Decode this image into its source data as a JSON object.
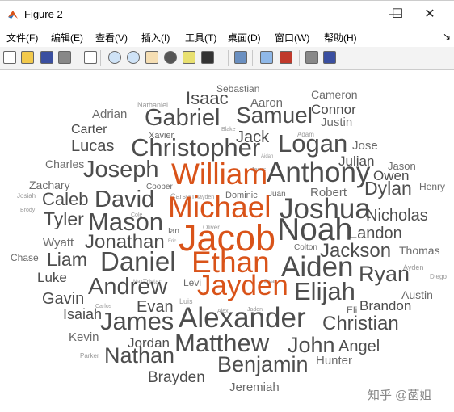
{
  "window": {
    "title": "Figure 2",
    "minimize": "—",
    "maximize": "☐",
    "close": "✕"
  },
  "menu": [
    "文件(F)",
    "编辑(E)",
    "查看(V)",
    "插入(I)",
    "工具(T)",
    "桌面(D)",
    "窗口(W)",
    "帮助(H)"
  ],
  "menu_overflow": "↘",
  "toolbar": [
    "new-file-icon",
    "open-folder-icon",
    "save-icon",
    "print-icon",
    "pointer-icon",
    "zoom-in-icon",
    "zoom-out-icon",
    "pan-icon",
    "rotate-3d-icon",
    "data-cursor-icon",
    "brush-icon",
    "link-plot-icon",
    "colorbar-icon",
    "legend-icon",
    "hide-plot-tools-icon",
    "show-plot-tools-icon"
  ],
  "colors": {
    "primary": "#4d4d4d",
    "highlight": "#d95319"
  },
  "wordcloud": {
    "highlighted": [
      "Jacob",
      "Michael",
      "Ethan",
      "William",
      "Jayden"
    ],
    "words": [
      "Sebastian",
      "Isaac",
      "Nathaniel",
      "Aaron",
      "Cameron",
      "Connor",
      "Adrian",
      "Gabriel",
      "Samuel",
      "Justin",
      "Carter",
      "Blake",
      "Xavier",
      "Adam",
      "Jack",
      "Lucas",
      "Christopher",
      "Logan",
      "Jose",
      "Aidan",
      "Charles",
      "Julian",
      "Jason",
      "Joseph",
      "Jesus",
      "William",
      "Anthony",
      "Owen",
      "Zachary",
      "Cooper",
      "Henry",
      "Dylan",
      "Josiah",
      "Caleb",
      "Carson",
      "Hayden",
      "Dominic",
      "Juan",
      "Robert",
      "David",
      "Michael",
      "Joshua",
      "Nicholas",
      "Brody",
      "Tyler",
      "Cole",
      "Mason",
      "Noah",
      "Landon",
      "Oliver",
      "Jacob",
      "Wyatt",
      "Ian",
      "Jonathan",
      "Eric",
      "Colton",
      "Thomas",
      "Chase",
      "Jackson",
      "Liam",
      "Daniel",
      "Ethan",
      "Aiden",
      "Ryan",
      "Ayden",
      "Luke",
      "Max",
      "Tristan",
      "Levi",
      "Bryan",
      "Diego",
      "Andrew",
      "Jayden",
      "Elijah",
      "Gavin",
      "Austin",
      "Evan",
      "Luis",
      "Carlos",
      "Brandon",
      "Isaiah",
      "Eli",
      "James",
      "Alex",
      "Jaden",
      "Alexander",
      "Christian",
      "Kevin",
      "Jordan",
      "Matthew",
      "John",
      "Angel",
      "Parker",
      "Nathan",
      "Hunter",
      "Benjamin",
      "Brayden",
      "Jeremiah"
    ]
  },
  "watermark": "知乎 @菡姐"
}
